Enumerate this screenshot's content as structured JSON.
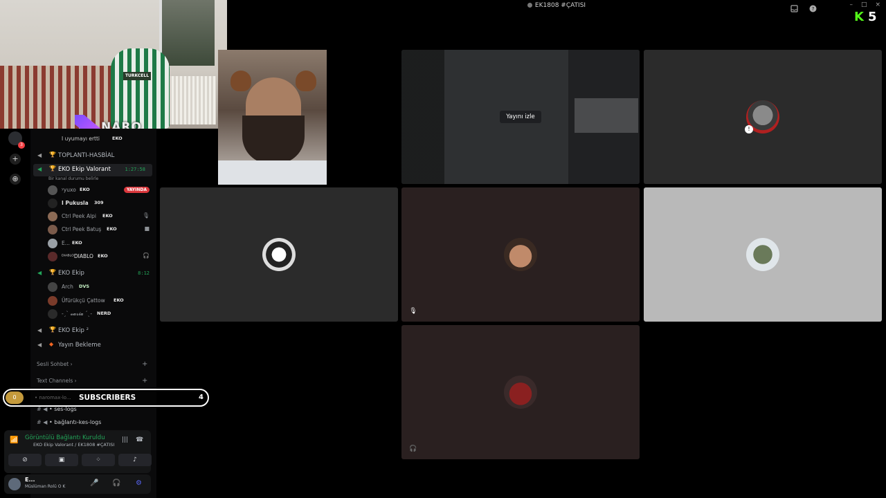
{
  "window": {
    "title": "EK1808 #ÇATISI",
    "controls": [
      "–",
      "□",
      "×"
    ]
  },
  "stream_overlay": {
    "kick_logo": "K",
    "kick_count": "5",
    "naro_logo": "NARO",
    "subscribers": {
      "coin": "0",
      "label": "SUBSCRIBERS",
      "count": "4",
      "hidden_text": "• naromax-lo..."
    }
  },
  "webcam": {
    "shirt_text": "TURKCELL"
  },
  "server_rail": {
    "badge": "3",
    "add_icon": "+",
    "discover_icon": "⊕"
  },
  "sidebar": {
    "channels_top": [
      {
        "label": "I uyumayı ertti",
        "tag": "EKO",
        "type": "user"
      }
    ],
    "voice_channels": [
      {
        "label": "TOPLANTI-HASBİAL",
        "time": ""
      },
      {
        "label": "EKO Ekip Valorant",
        "time": "1:27:58",
        "active": true
      }
    ],
    "status_note": "Bir kanal durumu belirle",
    "valorant_users": [
      {
        "name": "ʸyuxo",
        "tag": "EKO",
        "live": "YAYINDA"
      },
      {
        "name": "I Pukusla",
        "tag": "309"
      },
      {
        "name": "Ctrl Peek Alpi",
        "tag": "EKO"
      },
      {
        "name": "Ctrl Peek Batuş",
        "tag": "EKO"
      },
      {
        "name": "E...",
        "tag": "EKO"
      },
      {
        "name": "ᴰᴵᴬᴮᴸᴼDIABLO",
        "tag": "EKO"
      }
    ],
    "ekip_channel": {
      "label": "EKO Ekip",
      "time": "8:12"
    },
    "ekip_users": [
      {
        "name": "Arch",
        "tag": "DVS"
      },
      {
        "name": "Üfürükçü Çattow",
        "tag": "EKO"
      },
      {
        "name": "-ˏˋ 𝓿𝓪𝓻𝓲𝓪 ˊˎ-",
        "tag": "NERD"
      }
    ],
    "more_channels": [
      {
        "label": "EKO Ekip ²"
      },
      {
        "label": "Yayın Bekleme"
      }
    ],
    "categories": [
      {
        "label": "Sesli Sohbet ›"
      },
      {
        "label": "Text Channels ›"
      }
    ],
    "text_channels": [
      "• ses-logs",
      "• bağlantı-kes-logs"
    ]
  },
  "voice_panel": {
    "title": "Görüntülü Bağlantı Kuruldu",
    "subtitle": "EKO Ekip Valorant / EK1808 #ÇATISI"
  },
  "user_panel": {
    "name": "E...",
    "status": "Müslüman Rolü O K"
  },
  "grid": {
    "stream_button": "Yayını izle"
  }
}
